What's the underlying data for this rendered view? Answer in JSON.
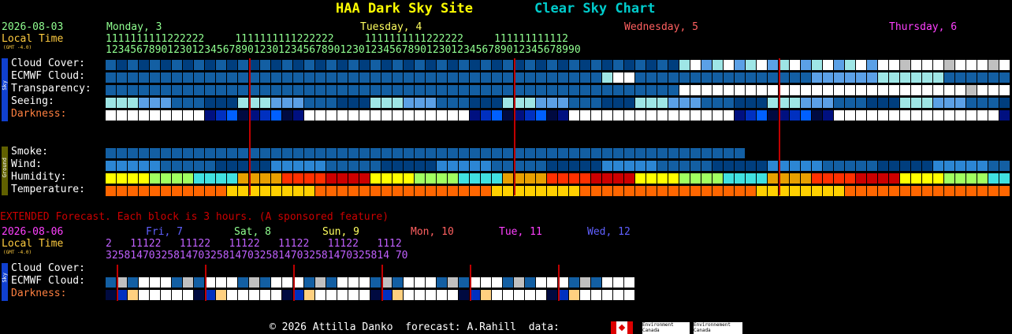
{
  "header": {
    "title_site": "HAA Dark Sky Site",
    "title_chart": "Clear Sky Chart",
    "date": "2026-08-03",
    "local_time": "Local Time",
    "gmt": "(GMT -4.0)",
    "days": [
      {
        "label": "Monday, 3",
        "color": "#90ff90"
      },
      {
        "label": "Tuesday, 4",
        "color": "#ffff60"
      },
      {
        "label": "Wednesday, 5",
        "color": "#ff6060"
      },
      {
        "label": "Thursday, 6",
        "color": "#ff40ff"
      }
    ],
    "hours_tens": "1111111111222222     1111111111222222     1111111111222222     111111111112",
    "hours_ones": "12345678901230123456789012301234567890123012345678901230123456789012345678990"
  },
  "sidebar": {
    "sky": "Sky",
    "ground": "Ground"
  },
  "rows_main": [
    {
      "key": "cloud",
      "label": "Cloud Cover:"
    },
    {
      "key": "ecmwf",
      "label": "ECMWF Cloud:"
    },
    {
      "key": "transp",
      "label": "Transparency:"
    },
    {
      "key": "seeing",
      "label": "Seeing:"
    },
    {
      "key": "dark",
      "label": "Darkness:"
    }
  ],
  "rows_ground": [
    {
      "key": "smoke",
      "label": "Smoke:"
    },
    {
      "key": "wind",
      "label": "Wind:"
    },
    {
      "key": "humid",
      "label": "Humidity:"
    },
    {
      "key": "temp",
      "label": "Temperature:"
    }
  ],
  "extended": {
    "banner": "EXTENDED Forecast. Each block is 3 hours. (A sponsored feature)",
    "date": "2026-08-06",
    "local_time": "Local Time",
    "gmt": "(GMT -4.0)",
    "days": [
      {
        "label": "Fri, 7",
        "color": "#6060ff"
      },
      {
        "label": "Sat, 8",
        "color": "#90ff90"
      },
      {
        "label": "Sun, 9",
        "color": "#ffff60"
      },
      {
        "label": "Mon, 10",
        "color": "#ff6060"
      },
      {
        "label": "Tue, 11",
        "color": "#ff40ff"
      },
      {
        "label": "Wed, 12",
        "color": "#6060ff"
      }
    ],
    "hours_row1": "2   11122   11122   11122   11122   11122   1112",
    "hours_row2": "3258147032581470325814703258147032581470325814 70",
    "rows": [
      {
        "key": "xcloud",
        "label": "Cloud Cover:"
      },
      {
        "key": "xecmwf",
        "label": "ECMWF Cloud:"
      },
      {
        "key": "xdark",
        "label": "Darkness:"
      }
    ]
  },
  "footer": {
    "text": "© 2026 Attilla Danko  forecast: A.Rahill  data:",
    "env1": "Environment Canada",
    "env2": "Environnement Canada"
  },
  "colors": {
    "blue_dark": "#003e7e",
    "blue_mid": "#135fa3",
    "blue_light": "#2c86d4",
    "blue_pale": "#5ba0e6",
    "cyan_pale": "#9ee6e6",
    "white": "#ffffff",
    "gray": "#c0c0c0",
    "red": "#cc0000",
    "orange": "#ff6600"
  }
}
